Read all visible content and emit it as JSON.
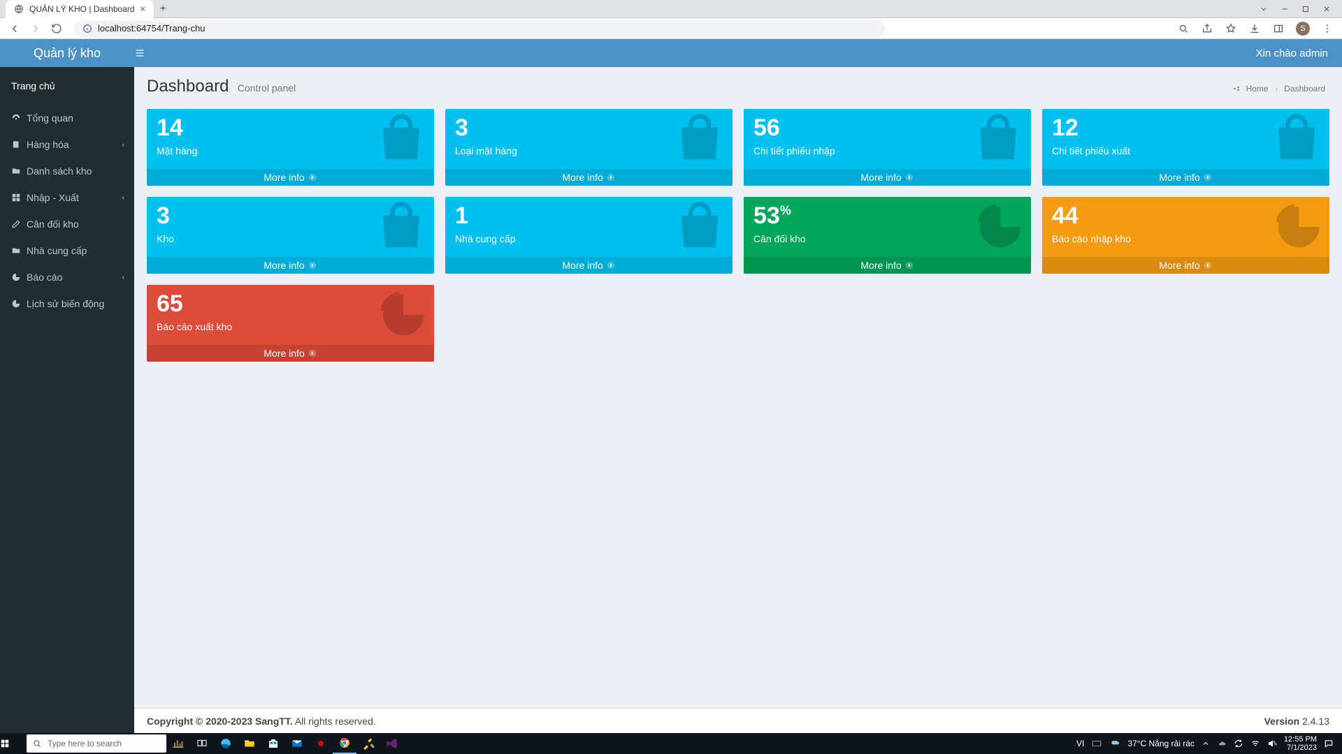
{
  "browser": {
    "tab_title": "QUẢN LÝ KHO | Dashboard",
    "url": "localhost:64754/Trang-chu",
    "avatar_initial": "S"
  },
  "topbar": {
    "brand": "Quản lý kho",
    "greeting": "Xin chào admin"
  },
  "sidebar": {
    "home": "Trang chủ",
    "items": [
      {
        "icon": "dashboard",
        "label": "Tổng quan",
        "caret": false
      },
      {
        "icon": "book",
        "label": "Hàng hóa",
        "caret": true
      },
      {
        "icon": "folder",
        "label": "Danh sách kho",
        "caret": false
      },
      {
        "icon": "grid",
        "label": "Nhập - Xuất",
        "caret": true
      },
      {
        "icon": "edit",
        "label": "Cân đối kho",
        "caret": false
      },
      {
        "icon": "folder",
        "label": "Nhà cung cấp",
        "caret": false
      },
      {
        "icon": "pie",
        "label": "Báo cáo",
        "caret": true
      },
      {
        "icon": "pie",
        "label": "Lịch sử biến động",
        "caret": false
      }
    ]
  },
  "page": {
    "title": "Dashboard",
    "subtitle": "Control panel",
    "breadcrumb_home": "Home",
    "breadcrumb_current": "Dashboard"
  },
  "cards": [
    {
      "value": "14",
      "suffix": "",
      "label": "Mặt hàng",
      "color": "aqua",
      "icon": "bag"
    },
    {
      "value": "3",
      "suffix": "",
      "label": "Loại mặt hàng",
      "color": "aqua",
      "icon": "bag"
    },
    {
      "value": "56",
      "suffix": "",
      "label": "Chi tiết phiếu nhập",
      "color": "aqua",
      "icon": "bag"
    },
    {
      "value": "12",
      "suffix": "",
      "label": "Chi tiết phiếu xuất",
      "color": "aqua",
      "icon": "bag"
    },
    {
      "value": "3",
      "suffix": "",
      "label": "Kho",
      "color": "aqua",
      "icon": "bag"
    },
    {
      "value": "1",
      "suffix": "",
      "label": "Nhà cung cấp",
      "color": "aqua",
      "icon": "bag"
    },
    {
      "value": "53",
      "suffix": "%",
      "label": "Cân đối kho",
      "color": "green",
      "icon": "pie"
    },
    {
      "value": "44",
      "suffix": "",
      "label": "Báo cáo nhập kho",
      "color": "orange",
      "icon": "pie"
    },
    {
      "value": "65",
      "suffix": "",
      "label": "Báo cáo xuất kho",
      "color": "red",
      "icon": "pie"
    }
  ],
  "more_info": "More info",
  "footer": {
    "copyright_bold": "Copyright © 2020-2023 SangTT.",
    "copyright_rest": " All rights reserved.",
    "version_label": "Version",
    "version_value": " 2.4.13"
  },
  "taskbar": {
    "search_placeholder": "Type here to search",
    "lang": "VI",
    "weather": "37°C  Nắng rải rác",
    "time": "12:55 PM",
    "date": "7/1/2023"
  }
}
